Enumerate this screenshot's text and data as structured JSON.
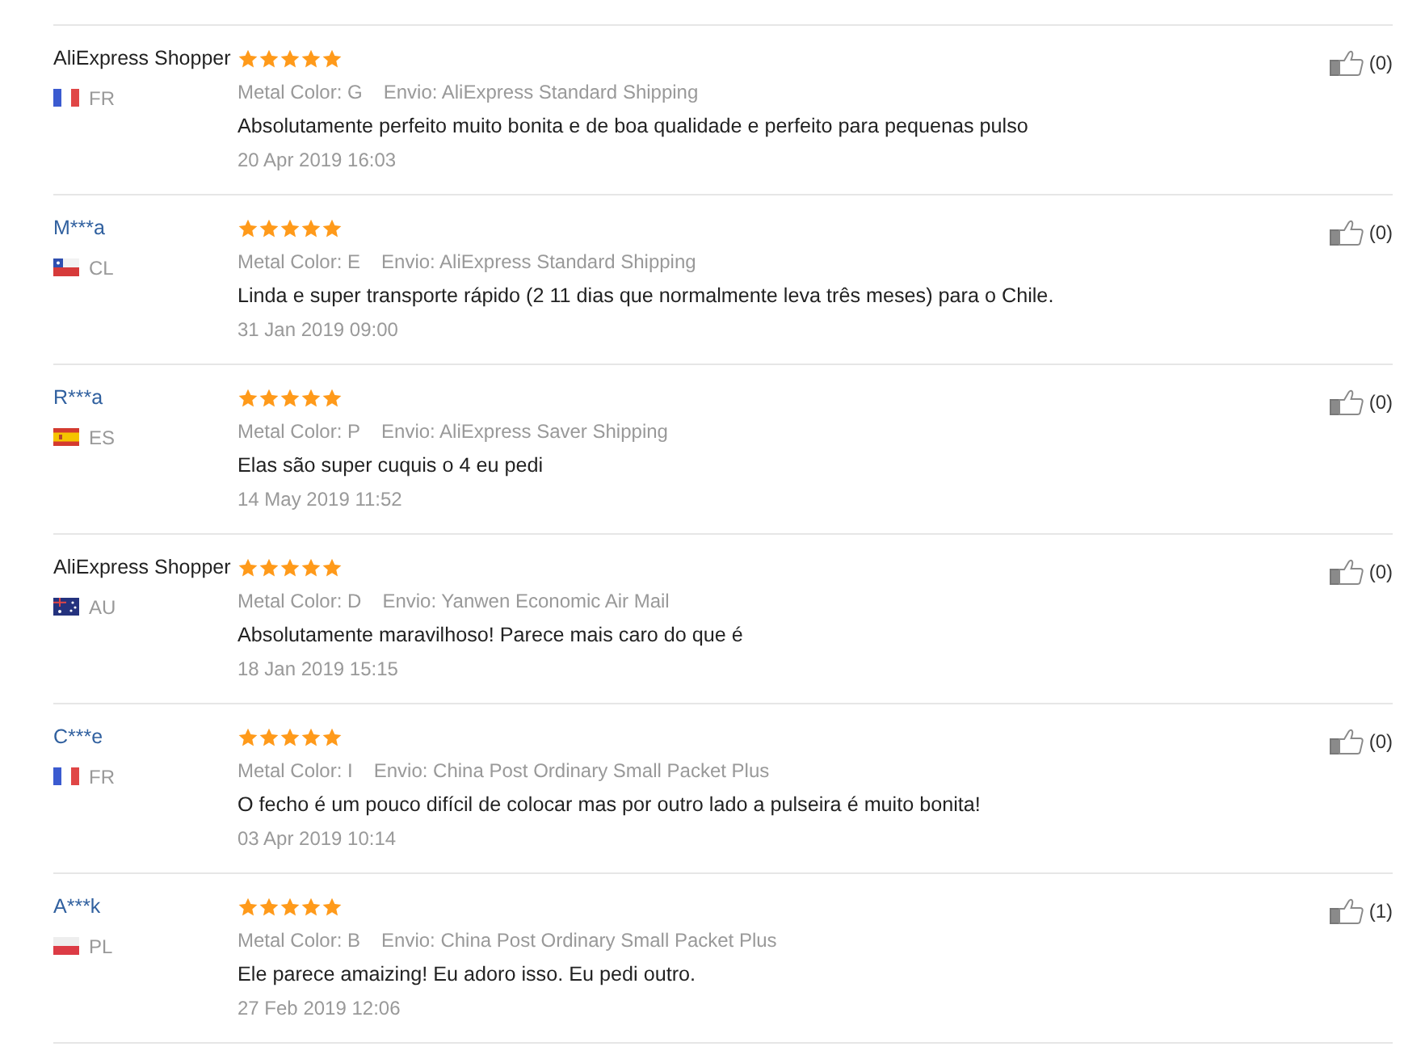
{
  "reviews": [
    {
      "reviewer": {
        "name": "AliExpress Shopper",
        "kind": "anonymous"
      },
      "country": {
        "code": "FR",
        "kind": "france"
      },
      "stars": 5,
      "metal_color": "Metal Color: G",
      "shipping": "Envio: AliExpress Standard Shipping",
      "text": "Absolutamente perfeito muito bonita e de boa qualidade e perfeito para pequenas pulso",
      "date": "20 Apr 2019 16:03",
      "helpful": "(0)"
    },
    {
      "reviewer": {
        "name": "M***a",
        "kind": "member"
      },
      "country": {
        "code": "CL",
        "kind": "chile"
      },
      "stars": 5,
      "metal_color": "Metal Color: E",
      "shipping": "Envio: AliExpress Standard Shipping",
      "text": "Linda e super transporte rápido (2 11 dias que normalmente leva três meses) para o Chile.",
      "date": "31 Jan 2019 09:00",
      "helpful": "(0)"
    },
    {
      "reviewer": {
        "name": "R***a",
        "kind": "member"
      },
      "country": {
        "code": "ES",
        "kind": "spain"
      },
      "stars": 5,
      "metal_color": "Metal Color: P",
      "shipping": "Envio: AliExpress Saver Shipping",
      "text": "Elas são super cuquis o 4 eu pedi",
      "date": "14 May 2019 11:52",
      "helpful": "(0)"
    },
    {
      "reviewer": {
        "name": "AliExpress Shopper",
        "kind": "anonymous"
      },
      "country": {
        "code": "AU",
        "kind": "australia"
      },
      "stars": 5,
      "metal_color": "Metal Color: D",
      "shipping": "Envio: Yanwen Economic Air Mail",
      "text": "Absolutamente maravilhoso! Parece mais caro do que é",
      "date": "18 Jan 2019 15:15",
      "helpful": "(0)"
    },
    {
      "reviewer": {
        "name": "C***e",
        "kind": "member"
      },
      "country": {
        "code": "FR",
        "kind": "france"
      },
      "stars": 5,
      "metal_color": "Metal Color: I",
      "shipping": "Envio: China Post Ordinary Small Packet Plus",
      "text": "O fecho é um pouco difícil de colocar mas por outro lado a pulseira é muito bonita!",
      "date": "03 Apr 2019 10:14",
      "helpful": "(0)"
    },
    {
      "reviewer": {
        "name": "A***k",
        "kind": "member"
      },
      "country": {
        "code": "PL",
        "kind": "poland"
      },
      "stars": 5,
      "metal_color": "Metal Color: B",
      "shipping": "Envio: China Post Ordinary Small Packet Plus",
      "text": "Ele parece amaizing! Eu adoro isso. Eu pedi outro.",
      "date": "27 Feb 2019 12:06",
      "helpful": "(1)"
    }
  ]
}
